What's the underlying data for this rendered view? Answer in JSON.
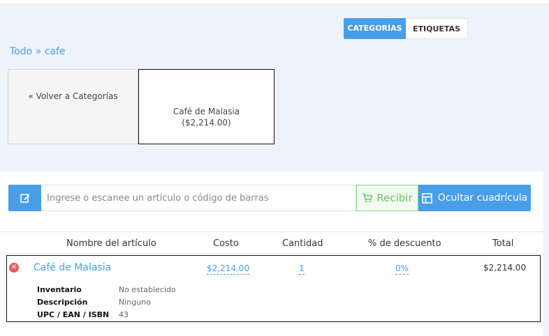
{
  "tabs": {
    "categories": "CATEGORÍAS",
    "tags": "ETIQUETAS"
  },
  "breadcrumb": {
    "root": "Todo",
    "separator": "»",
    "current": "cafe"
  },
  "tiles": {
    "back": "« Volver a Categorías",
    "item_name": "Café de Malasia",
    "item_price": "($2,214.00)"
  },
  "scan": {
    "placeholder": "Ingrese o escanee un artículo o código de barras",
    "receive_label": "Recibir",
    "grid_label": "Ocultar cuadrícula"
  },
  "table": {
    "headers": {
      "name": "Nombre del artículo",
      "cost": "Costo",
      "quantity": "Cantidad",
      "discount": "% de descuento",
      "total": "Total"
    },
    "row": {
      "name": "Café de Malasia",
      "cost": "$2,214.00",
      "quantity": "1",
      "discount": "0%",
      "total": "$2,214.00",
      "details": [
        {
          "label": "Inventario",
          "value": "No establecido"
        },
        {
          "label": "Descripción",
          "value": "Ninguno"
        },
        {
          "label": "UPC / EAN / ISBN",
          "value": "43"
        }
      ]
    }
  },
  "colors": {
    "accent": "#489ee7",
    "success": "#6bc36b",
    "danger": "#e65c5c"
  }
}
